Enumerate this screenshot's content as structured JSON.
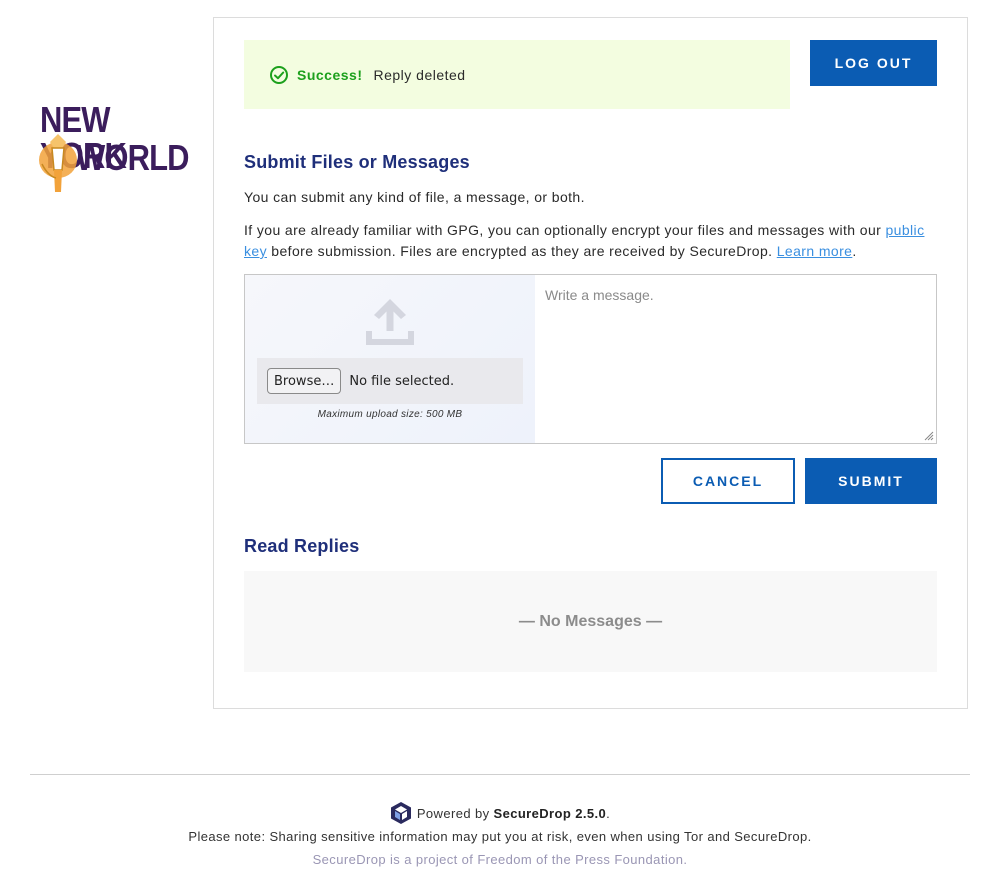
{
  "logo": {
    "line1": "NEW YORK",
    "line2": "WORLD",
    "color": "#3b1d5c",
    "icon": "torch-icon"
  },
  "flash": {
    "title": "Success!",
    "message": "Reply deleted",
    "icon": "check-circle-icon",
    "color": "#1ca01c",
    "background": "#f3fde0"
  },
  "header": {
    "logout_label": "LOG OUT"
  },
  "submit_section": {
    "title": "Submit Files or Messages",
    "intro": "You can submit any kind of file, a message, or both.",
    "gpg_text_before": "If you are already familiar with GPG, you can optionally encrypt your files and messages with our ",
    "public_key_link": "public key",
    "gpg_text_middle": " before submission. Files are encrypted as they are received by SecureDrop. ",
    "learn_more_link": "Learn more",
    "gpg_text_after": "."
  },
  "upload": {
    "icon": "upload-icon",
    "browse_label": "Browse…",
    "file_status": "No file selected.",
    "max_size": "Maximum upload size: 500 MB"
  },
  "message": {
    "placeholder": "Write a message.",
    "value": ""
  },
  "actions": {
    "cancel_label": "CANCEL",
    "submit_label": "SUBMIT",
    "accent": "#0b5cb3"
  },
  "replies": {
    "title": "Read Replies",
    "empty_text": "— No Messages —"
  },
  "footer": {
    "powered_by": "Powered by",
    "product": "SecureDrop 2.5.0",
    "period": ".",
    "note": "Please note: Sharing sensitive information may put you at risk, even when using Tor and SecureDrop.",
    "project": "SecureDrop is a project of Freedom of the Press Foundation.",
    "icon": "securedrop-cube-icon"
  }
}
